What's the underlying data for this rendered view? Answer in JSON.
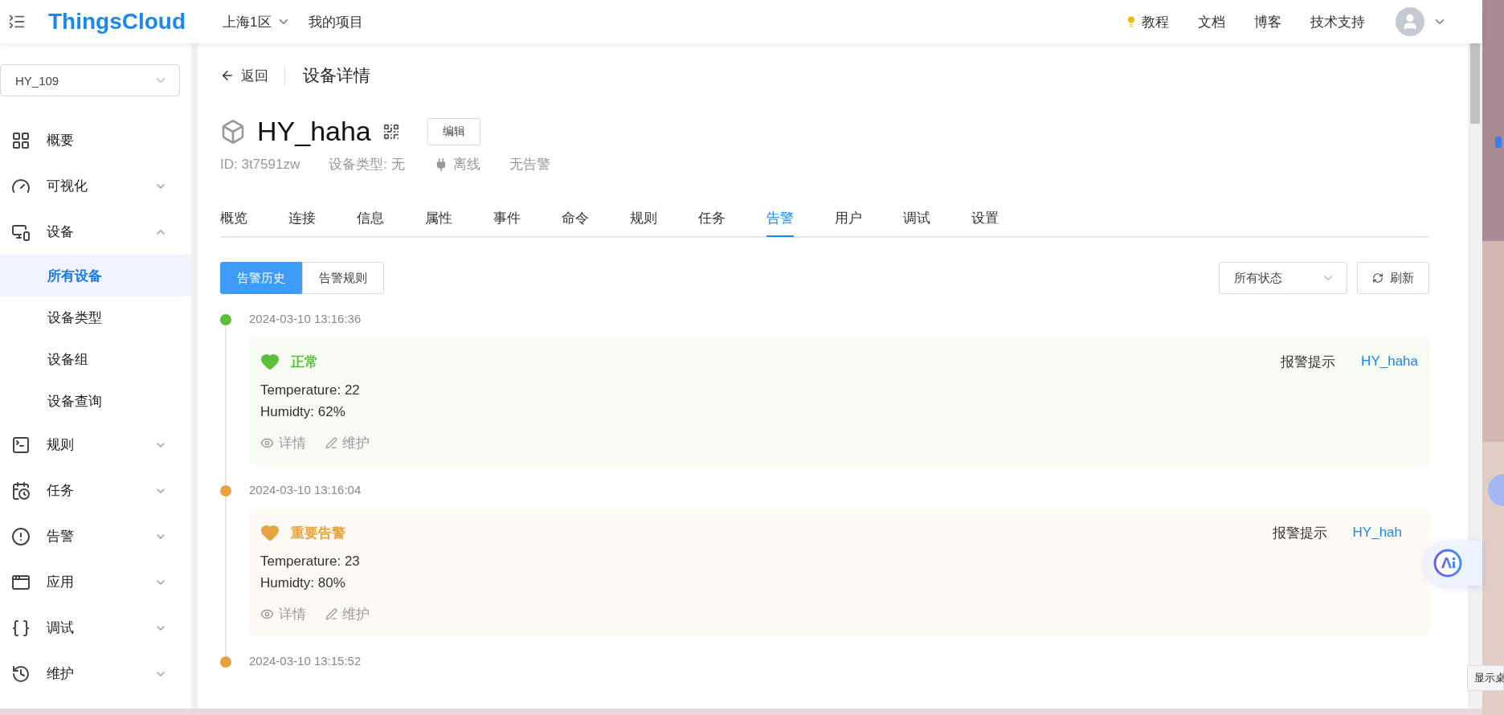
{
  "topbar": {
    "logo": "ThingsCloud",
    "region": "上海1区",
    "project": "我的项目",
    "links": [
      {
        "label": "教程",
        "kind": "tip"
      },
      {
        "label": "文档",
        "kind": "plain"
      },
      {
        "label": "博客",
        "kind": "plain"
      },
      {
        "label": "技术支持",
        "kind": "plain"
      }
    ]
  },
  "sidebar": {
    "project_select": "HY_109",
    "menu": [
      {
        "label": "概要"
      },
      {
        "label": "可视化",
        "expanded": false
      },
      {
        "label": "设备",
        "expanded": true,
        "children": [
          {
            "label": "所有设备",
            "selected": true
          },
          {
            "label": "设备类型",
            "selected": false
          },
          {
            "label": "设备组",
            "selected": false
          },
          {
            "label": "设备查询",
            "selected": false
          }
        ]
      },
      {
        "label": "规则",
        "expanded": false
      },
      {
        "label": "任务",
        "expanded": false
      },
      {
        "label": "告警",
        "expanded": false
      },
      {
        "label": "应用",
        "expanded": false
      },
      {
        "label": "调试",
        "expanded": false
      },
      {
        "label": "维护",
        "expanded": false
      }
    ]
  },
  "header": {
    "back": "返回",
    "title": "设备详情"
  },
  "device": {
    "name": "HY_haha",
    "edit": "编辑",
    "id": "ID: 3t7591zw",
    "type": "设备类型: 无",
    "status": "离线",
    "alarm": "无告警"
  },
  "tabs": [
    {
      "label": "概览",
      "selected": false
    },
    {
      "label": "连接",
      "selected": false
    },
    {
      "label": "信息",
      "selected": false
    },
    {
      "label": "属性",
      "selected": false
    },
    {
      "label": "事件",
      "selected": false
    },
    {
      "label": "命令",
      "selected": false
    },
    {
      "label": "规则",
      "selected": false
    },
    {
      "label": "任务",
      "selected": false
    },
    {
      "label": "告警",
      "selected": true
    },
    {
      "label": "用户",
      "selected": false
    },
    {
      "label": "调试",
      "selected": false
    },
    {
      "label": "设置",
      "selected": false
    }
  ],
  "subtabs": [
    {
      "label": "告警历史",
      "selected": true
    },
    {
      "label": "告警规则",
      "selected": false
    }
  ],
  "filter": {
    "value": "所有状态"
  },
  "refresh": "刷新",
  "alarms": [
    {
      "time": "2024-03-10 13:16:36",
      "kind": "normal",
      "level": "正常",
      "lines": [
        "Temperature: 22",
        "Humidty: 62%"
      ],
      "rule": "报警提示",
      "device": "HY_haha",
      "actions": [
        "详情",
        "维护"
      ]
    },
    {
      "time": "2024-03-10 13:16:04",
      "kind": "major",
      "level": "重要告警",
      "lines": [
        "Temperature: 23",
        "Humidty: 80%"
      ],
      "rule": "报警提示",
      "device": "HY_hah",
      "actions": [
        "详情",
        "维护"
      ]
    },
    {
      "time": "2024-03-10 13:15:52",
      "kind": "major"
    }
  ],
  "desktop": {
    "tooltip": "显示桌"
  }
}
